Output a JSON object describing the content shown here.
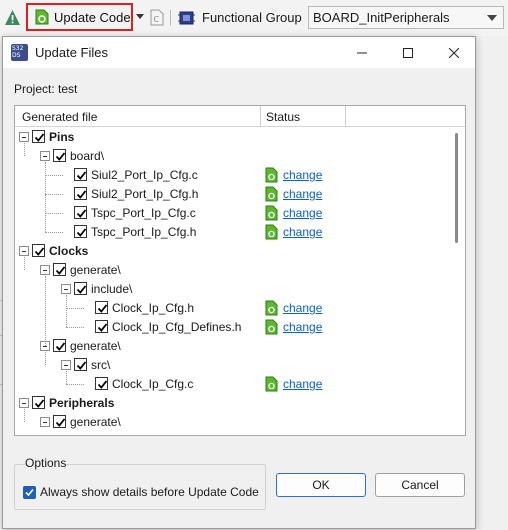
{
  "toolbar": {
    "update_code_label": "Update Code",
    "functional_group_label": "Functional Group",
    "functional_group_value": "BOARD_InitPeripherals"
  },
  "dialog": {
    "title": "Update Files",
    "project_label": "Project: test",
    "columns": [
      "Generated file",
      "Status"
    ],
    "options_legend": "Options",
    "always_show_label": "Always show details before Update Code",
    "always_show_checked": true,
    "ok_label": "OK",
    "cancel_label": "Cancel"
  },
  "tree": [
    {
      "label": "Pins",
      "bold": true,
      "checked": true,
      "expanded": true
    },
    {
      "label": "board\\",
      "checked": true,
      "expanded": true
    },
    {
      "label": "Siul2_Port_Ip_Cfg.c",
      "checked": true,
      "status": "change"
    },
    {
      "label": "Siul2_Port_Ip_Cfg.h",
      "checked": true,
      "status": "change"
    },
    {
      "label": "Tspc_Port_Ip_Cfg.c",
      "checked": true,
      "status": "change"
    },
    {
      "label": "Tspc_Port_Ip_Cfg.h",
      "checked": true,
      "status": "change"
    },
    {
      "label": "Clocks",
      "bold": true,
      "checked": true,
      "expanded": true
    },
    {
      "label": "generate\\",
      "checked": true,
      "expanded": true
    },
    {
      "label": "include\\",
      "checked": true,
      "expanded": true
    },
    {
      "label": "Clock_Ip_Cfg.h",
      "checked": true,
      "status": "change"
    },
    {
      "label": "Clock_Ip_Cfg_Defines.h",
      "checked": true,
      "status": "change"
    },
    {
      "label": "generate\\",
      "checked": true,
      "expanded": true
    },
    {
      "label": "src\\",
      "checked": true,
      "expanded": true
    },
    {
      "label": "Clock_Ip_Cfg.c",
      "checked": true,
      "status": "change"
    },
    {
      "label": "Peripherals",
      "bold": true,
      "checked": true,
      "expanded": true
    },
    {
      "label": "generate\\",
      "checked": true,
      "expanded": true
    }
  ],
  "colors": {
    "highlight_border": "#e02020",
    "link": "#0b5ed7",
    "status_icon": "#5cb82e",
    "accent_checkbox": "#1e5fb8"
  },
  "icons": {
    "warning": "warning-icon",
    "update_code": "gear-icon",
    "status": "file-change-icon"
  }
}
